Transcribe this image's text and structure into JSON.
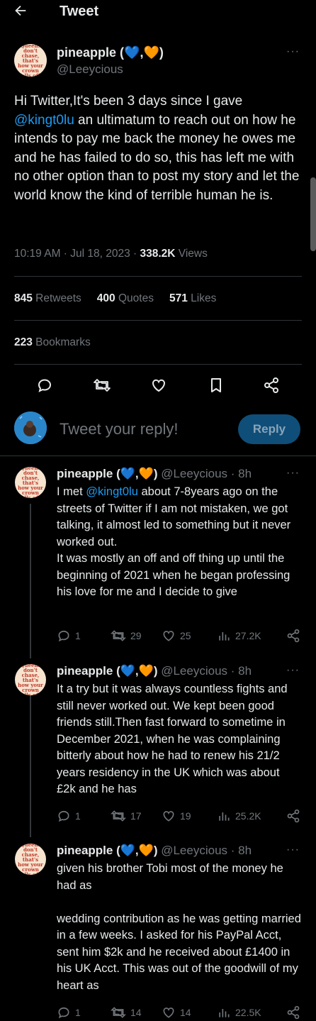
{
  "header": {
    "back_icon": "arrow-left-icon",
    "title": "Tweet"
  },
  "tweet": {
    "avatar_text": "Queens don't chase, that's how your crown falls off.",
    "author_name": "pineapple (",
    "author_hearts_1": "💙",
    "author_sep": ",",
    "author_hearts_2": "🧡",
    "author_close": ")",
    "handle": "@Leeycious",
    "more": "···",
    "text_before_mention": "Hi Twitter,It's been 3 days since I gave ",
    "mention": "@kingt0lu",
    "text_after_mention": " an ultimatum to reach out on how he intends to pay me back the money he owes me and he has failed to do so, this has left me with no other option than to post my story and let the world know the kind of terrible human he is.",
    "time": "10:19 AM · Jul 18, 2023 · ",
    "views_count": "338.2K",
    "views_label": " Views",
    "retweets_count": "845",
    "retweets_label": " Retweets",
    "quotes_count": "400",
    "quotes_label": " Quotes",
    "likes_count": "571",
    "likes_label": " Likes",
    "bookmarks_count": "223",
    "bookmarks_label": " Bookmarks"
  },
  "composer": {
    "placeholder": "Tweet your reply!",
    "reply_button": "Reply"
  },
  "replies": [
    {
      "name": "pineapple (",
      "close": ")",
      "handle": "@Leeycious · 8h",
      "text_before": "I met ",
      "mention": "@kingt0lu",
      "text_after": " about 7-8years ago on the streets of Twitter if I am not mistaken, we got talking, it almost led to something but it never worked out.\nIt was mostly an off and off thing up until the beginning of 2021 when he began professing his love for me and I decide to give",
      "replies": "1",
      "retweets": "29",
      "likes": "25",
      "views": "27.2K"
    },
    {
      "name": "pineapple (",
      "close": ")",
      "handle": "@Leeycious · 8h",
      "text_before": "It a try but it was always countless fights and still never worked out. We kept been good friends still.Then fast forward to sometime in December 2021, when he was complaining bitterly about how he had to renew his 21/2 years residency in the UK which was about £2k and he has",
      "mention": "",
      "text_after": "",
      "replies": "1",
      "retweets": "17",
      "likes": "19",
      "views": "25.2K"
    },
    {
      "name": "pineapple (",
      "close": ")",
      "handle": "@Leeycious · 8h",
      "text_before": "given his brother Tobi most of the money he had as\n\nwedding contribution as he was getting married in a few weeks. I asked for his PayPal Acct, sent him $2k and he received about £1400 in his UK Acct. This was out of the goodwill of my heart as",
      "mention": "",
      "text_after": "",
      "replies": "1",
      "retweets": "14",
      "likes": "14",
      "views": "22.5K"
    }
  ],
  "colors": {
    "accent": "#1d9bf0",
    "background": "#000000",
    "muted": "#71767b"
  }
}
